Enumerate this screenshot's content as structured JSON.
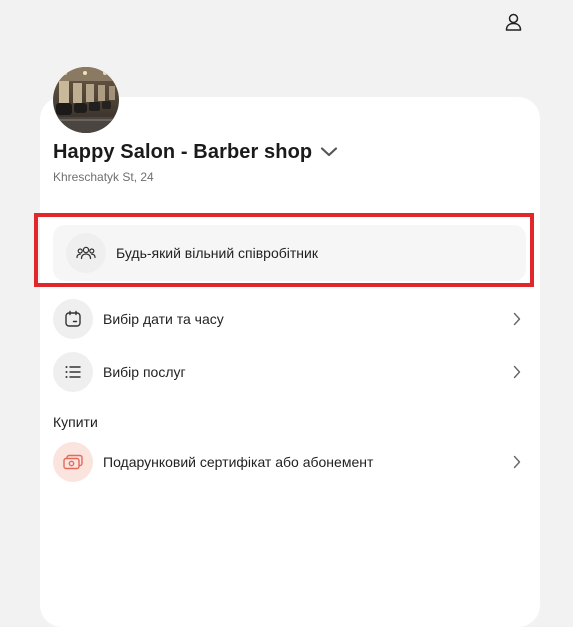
{
  "header": {
    "profile_icon": "user-icon"
  },
  "salon": {
    "name": "Happy Salon - Barber shop",
    "address": "Khreschatyk St, 24",
    "avatar_icon": "salon-photo"
  },
  "menu": {
    "staff_label": "Будь-який вільний співробітник",
    "datetime_label": "Вибір дати та часу",
    "services_label": "Вибір послуг"
  },
  "purchase": {
    "section_title": "Купити",
    "gift_label": "Подарунковий сертифікат або абонемент"
  },
  "colors": {
    "highlight": "#e0282c",
    "gift_icon_bg": "#fbe3de",
    "gift_icon": "#e26a5a"
  }
}
